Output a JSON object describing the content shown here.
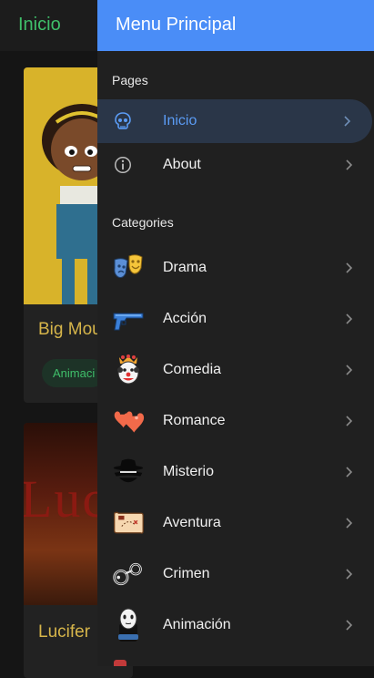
{
  "page": {
    "title": "Inicio"
  },
  "cards": [
    {
      "title": "Big Mou",
      "genre": "Animaci"
    },
    {
      "title": "Lucifer",
      "art_text": "Luc"
    }
  ],
  "drawer": {
    "title": "Menu Principal",
    "pages_label": "Pages",
    "categories_label": "Categories",
    "pages": [
      {
        "label": "Inicio",
        "icon": "skull-icon",
        "active": true
      },
      {
        "label": "About",
        "icon": "info-icon",
        "active": false
      }
    ],
    "categories": [
      {
        "label": "Drama",
        "icon": "theater-masks-icon"
      },
      {
        "label": "Acción",
        "icon": "gun-icon"
      },
      {
        "label": "Comedia",
        "icon": "clown-icon"
      },
      {
        "label": "Romance",
        "icon": "hearts-icon"
      },
      {
        "label": "Misterio",
        "icon": "detective-icon"
      },
      {
        "label": "Aventura",
        "icon": "treasure-map-icon"
      },
      {
        "label": "Crimen",
        "icon": "handcuffs-icon"
      },
      {
        "label": "Animación",
        "icon": "character-icon"
      }
    ]
  },
  "colors": {
    "accent": "#4a8df7",
    "active_text": "#5b9cf5",
    "page_title": "#3fbf6a",
    "card_title": "#d6b54a"
  }
}
